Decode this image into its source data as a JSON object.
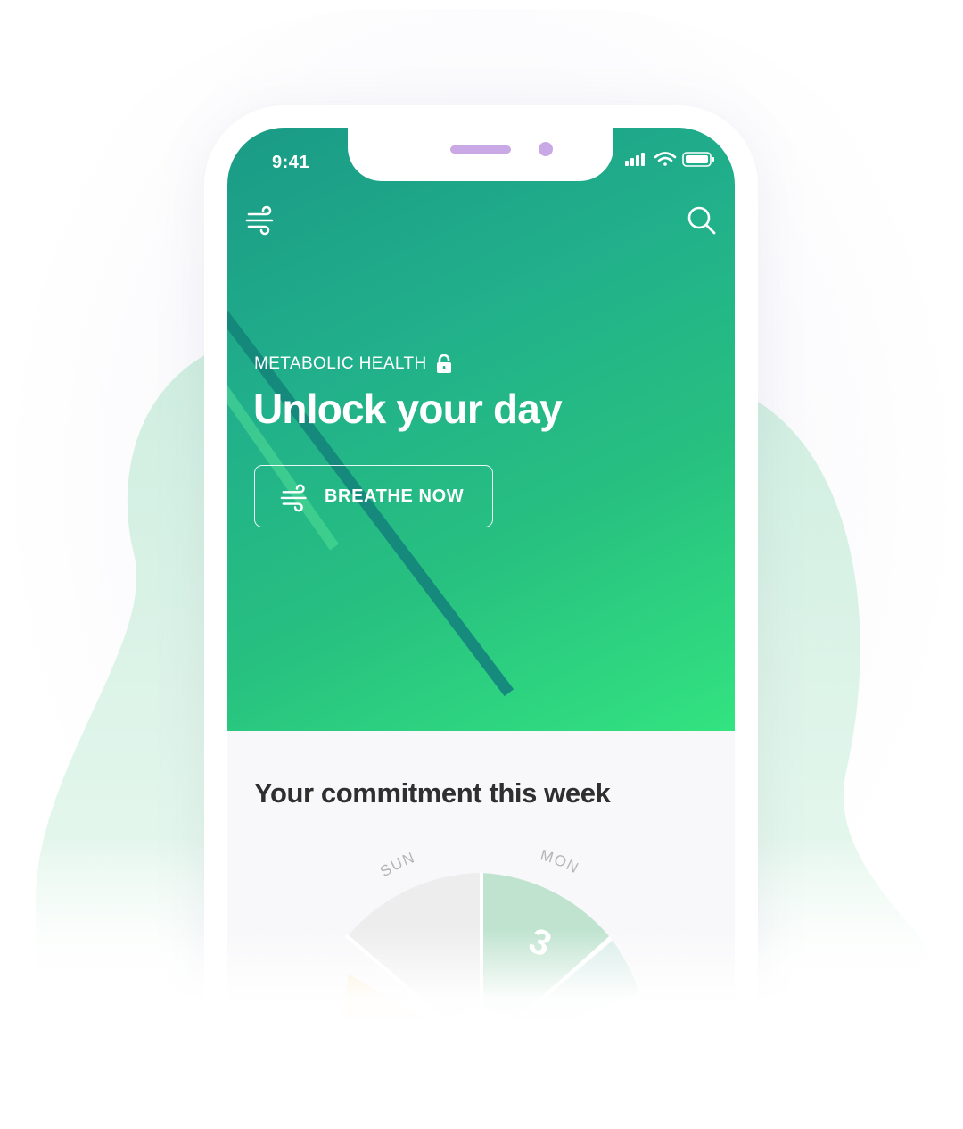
{
  "status_bar": {
    "time": "9:41",
    "icons": [
      "signal-icon",
      "wifi-icon",
      "battery-icon"
    ]
  },
  "header": {
    "menu_icon": "wind-icon",
    "search_icon": "search-icon"
  },
  "hero": {
    "eyebrow": "METABOLIC HEALTH",
    "eyebrow_icon": "lock-icon",
    "title": "Unlock your day",
    "cta_label": "BREATHE NOW",
    "cta_icon": "wind-icon"
  },
  "commitment": {
    "title": "Your commitment this week",
    "days": [
      {
        "label": "SUN",
        "value": ""
      },
      {
        "label": "MON",
        "value": "3"
      }
    ]
  },
  "colors": {
    "hero_gradient_start": "#1a9a86",
    "hero_gradient_end": "#33e380",
    "accent_mint": "#d6f1e3",
    "notch_dots": "#c9a8e6",
    "text_dark": "#2f2f2f"
  }
}
